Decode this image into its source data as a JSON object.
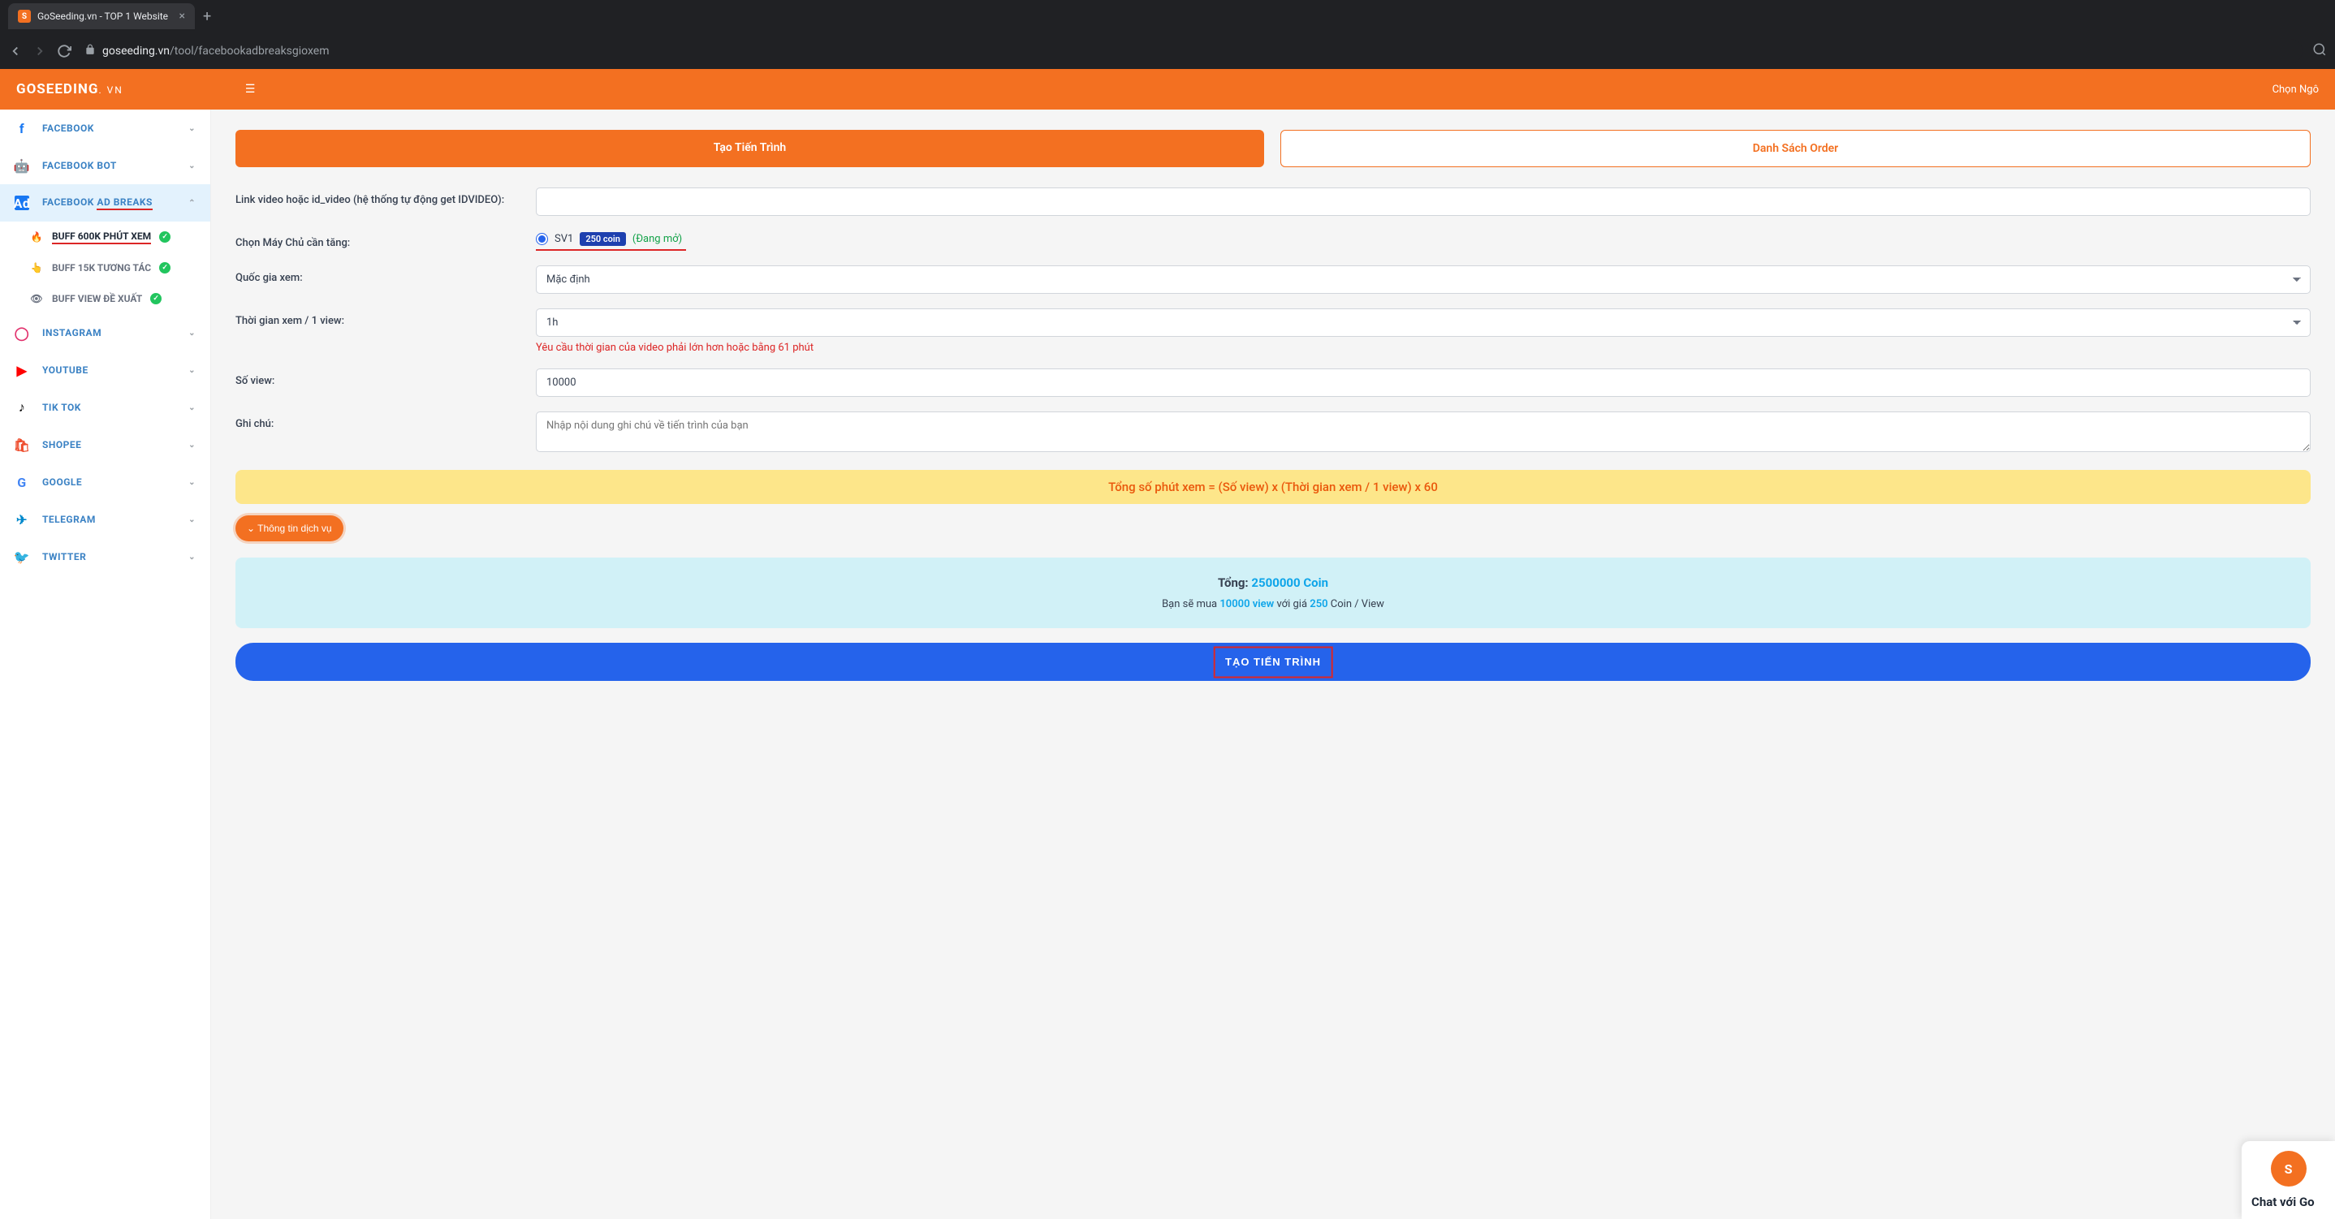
{
  "browser": {
    "tab_title": "GoSeeding.vn - TOP 1 Website",
    "url_domain": "goseeding.vn",
    "url_path": "/tool/facebookadbreaksgioxem"
  },
  "header": {
    "brand_main": "GOSEEDING",
    "brand_sub": ". VN",
    "right_text": "Chọn Ngô"
  },
  "sidebar": {
    "items": [
      {
        "label": "FACEBOOK"
      },
      {
        "label": "FACEBOOK BOT"
      },
      {
        "label": "FACEBOOK AD BREAKS"
      },
      {
        "label": "INSTAGRAM"
      },
      {
        "label": "YOUTUBE"
      },
      {
        "label": "TIK TOK"
      },
      {
        "label": "SHOPEE"
      },
      {
        "label": "GOOGLE"
      },
      {
        "label": "TELEGRAM"
      },
      {
        "label": "TWITTER"
      }
    ],
    "adbreaks_sub": [
      {
        "label": "BUFF 600K PHÚT XEM"
      },
      {
        "label": "BUFF 15K TƯƠNG TÁC"
      },
      {
        "label": "BUFF VIEW ĐỀ XUẤT"
      }
    ]
  },
  "tabs": {
    "create": "Tạo Tiến Trình",
    "list": "Danh Sách Order"
  },
  "form": {
    "link_label": "Link video hoặc id_video (hệ thống tự động get IDVIDEO):",
    "server_label": "Chọn Máy Chủ cần tăng:",
    "server_name": "SV1",
    "server_price": "250 coin",
    "server_status": "(Đang mở)",
    "country_label": "Quốc gia xem:",
    "country_value": "Mặc định",
    "time_label": "Thời gian xem / 1 view:",
    "time_value": "1h",
    "time_hint": "Yêu cầu thời gian của video phải lớn hơn hoặc bằng 61 phút",
    "views_label": "Số view:",
    "views_value": "10000",
    "note_label": "Ghi chú:",
    "note_placeholder": "Nhập nội dung ghi chú về tiến trình của bạn"
  },
  "info_banner": "Tổng số phút xem = (Số view) x (Thời gian xem / 1 view) x 60",
  "service_btn": "Thông tin dịch vụ",
  "total": {
    "label": "Tổng:",
    "amount": "2500000 Coin",
    "line2_pre": "Bạn sẽ mua",
    "line2_views": "10000 view",
    "line2_mid": "với giá",
    "line2_price": "250",
    "line2_suffix": "Coin / View"
  },
  "submit": "TẠO TIẾN TRÌNH",
  "chat": {
    "title": "Chat với Go"
  }
}
